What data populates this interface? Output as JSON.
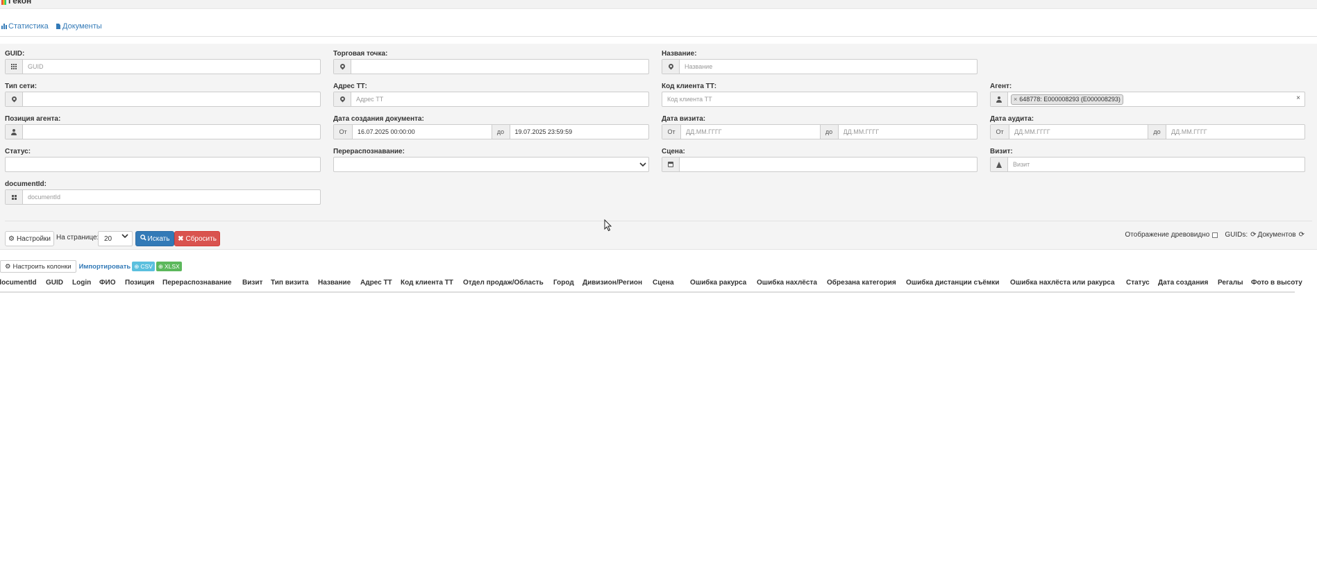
{
  "app": {
    "title": "Гекон"
  },
  "nav": {
    "statistics": "Статистика",
    "documents": "Документы"
  },
  "filters": {
    "guid": {
      "label": "GUID:",
      "placeholder": "GUID",
      "value": ""
    },
    "trade_point": {
      "label": "Торговая точка:",
      "value": ""
    },
    "name": {
      "label": "Название:",
      "placeholder": "Название",
      "value": ""
    },
    "network_type": {
      "label": "Тип сети:",
      "value": ""
    },
    "tt_address": {
      "label": "Адрес ТТ:",
      "placeholder": "Адрес ТТ",
      "value": ""
    },
    "tt_client_code": {
      "label": "Код клиента ТТ:",
      "placeholder": "Код клиента ТТ",
      "value": ""
    },
    "agent": {
      "label": "Агент:",
      "tag": "648778: E000008293 (E000008293)",
      "tag_remove": "×",
      "clear": "×"
    },
    "agent_position": {
      "label": "Позиция агента:",
      "value": ""
    },
    "doc_created": {
      "label": "Дата создания документа:",
      "from_label": "От",
      "to_label": "до",
      "from": "16.07.2025 00:00:00",
      "to": "19.07.2025 23:59:59"
    },
    "visit_date": {
      "label": "Дата визита:",
      "from_label": "От",
      "to_label": "до",
      "from_placeholder": "ДД.ММ.ГГГГ",
      "to_placeholder": "ДД.ММ.ГГГГ"
    },
    "audit_date": {
      "label": "Дата аудита:",
      "from_label": "От",
      "to_label": "до",
      "from_placeholder": "ДД.ММ.ГГГГ",
      "to_placeholder": "ДД.ММ.ГГГГ"
    },
    "status": {
      "label": "Статус:",
      "value": ""
    },
    "rerecognition": {
      "label": "Перераспознавание:",
      "value": ""
    },
    "scene": {
      "label": "Сцена:",
      "value": ""
    },
    "visit": {
      "label": "Визит:",
      "placeholder": "Визит",
      "value": ""
    },
    "document_id": {
      "label": "documentId:",
      "placeholder": "documentId",
      "value": ""
    }
  },
  "controls": {
    "settings": "Настройки",
    "per_page_label": "На странице:",
    "per_page_value": "20",
    "search": "Искать",
    "reset": "Сбросить",
    "tree_view": "Отображение древовидно",
    "guids_label": "GUIDs:",
    "documents_link": "Документов"
  },
  "table_tools": {
    "configure_columns": "Настроить колонки",
    "import": "Импортировать",
    "csv": "CSV",
    "xlsx": "XLSX"
  },
  "table": {
    "columns": [
      "documentId",
      "GUID",
      "Login",
      "ФИО",
      "Позиция",
      "Перераспознавание",
      "Визит",
      "Тип визита",
      "Название",
      "Адрес ТТ",
      "Код клиента ТТ",
      "Отдел продаж/Область",
      "Город",
      "Дивизион/Регион",
      "Сцена",
      "Ошибка ракурса",
      "Ошибка нахлёста",
      "Обрезана категория",
      "Ошибка дистанции съёмки",
      "Ошибка нахлёста или ракурса",
      "Статус",
      "Дата создания",
      "Регалы",
      "Фото в высоту"
    ]
  }
}
